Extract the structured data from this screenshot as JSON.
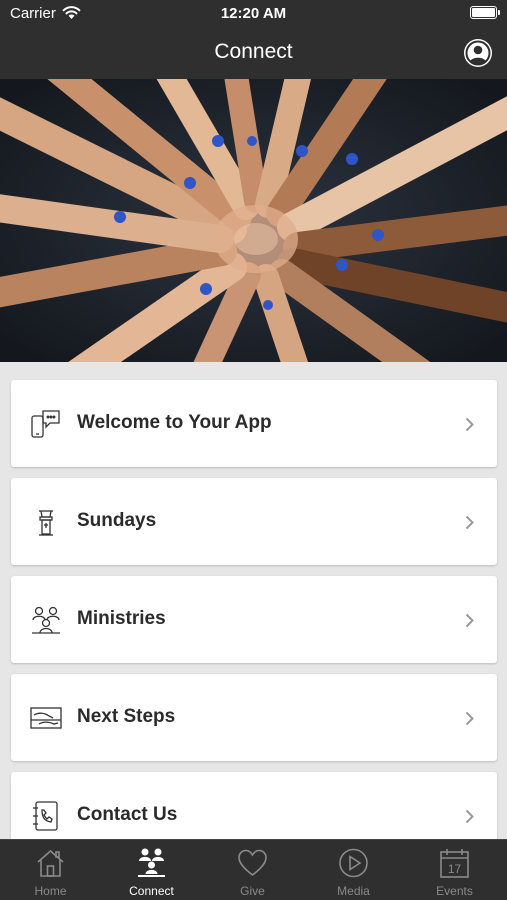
{
  "status_bar": {
    "carrier": "Carrier",
    "time": "12:20 AM",
    "wifi_icon": "wifi-icon",
    "battery_icon": "battery-icon"
  },
  "nav": {
    "title": "Connect",
    "profile_icon": "profile-icon"
  },
  "hero": {
    "image": "hands-together-photo"
  },
  "items": [
    {
      "label": "Welcome to Your App",
      "icon": "phone-chat-icon"
    },
    {
      "label": "Sundays",
      "icon": "podium-icon"
    },
    {
      "label": "Ministries",
      "icon": "group-icon"
    },
    {
      "label": "Next Steps",
      "icon": "steps-icon"
    },
    {
      "label": "Contact Us",
      "icon": "address-book-icon"
    }
  ],
  "tabs": [
    {
      "label": "Home",
      "icon": "home-icon",
      "active": false
    },
    {
      "label": "Connect",
      "icon": "connect-icon",
      "active": true
    },
    {
      "label": "Give",
      "icon": "heart-icon",
      "active": false
    },
    {
      "label": "Media",
      "icon": "play-icon",
      "active": false
    },
    {
      "label": "Events",
      "icon": "calendar-icon",
      "active": false
    }
  ],
  "colors": {
    "bar": "#2f2f2f",
    "background": "#e6e6e6",
    "card": "#ffffff",
    "text": "#2b2b2b",
    "tab_inactive": "#8a8a8a",
    "tab_active": "#ffffff"
  }
}
